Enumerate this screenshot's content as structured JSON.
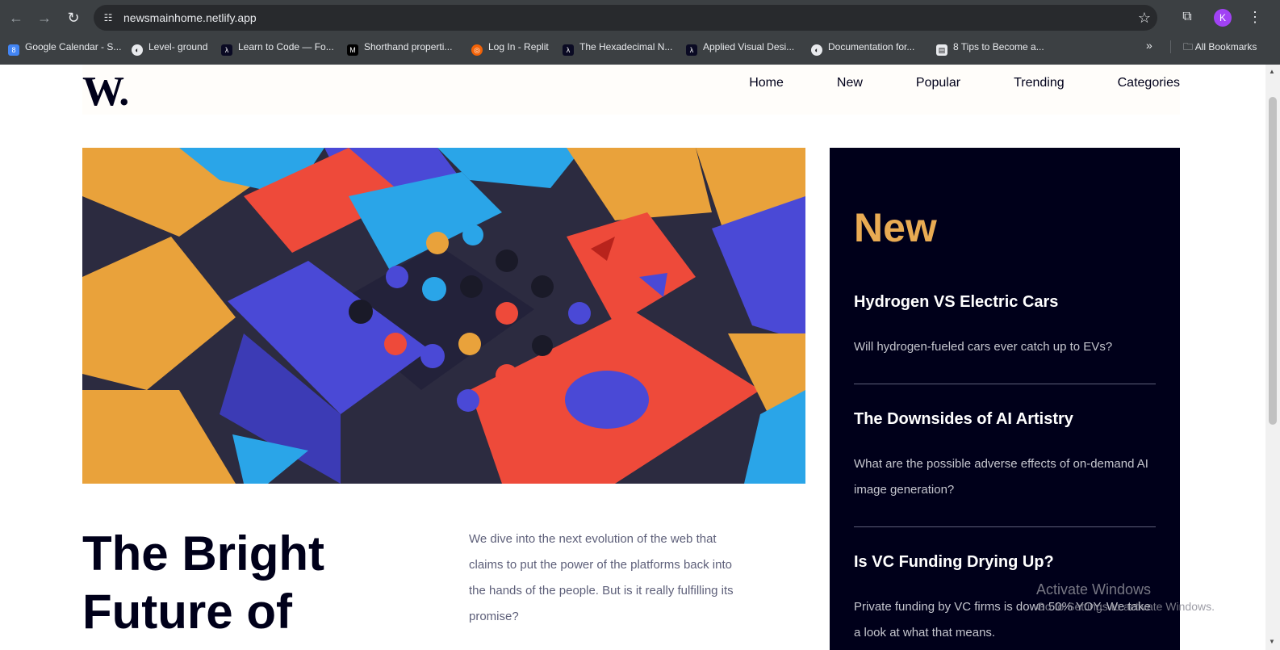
{
  "browser": {
    "url": "newsmainhome.netlify.app",
    "avatar_letter": "K",
    "bookmarks": [
      {
        "label": "Google Calendar - S...",
        "icon": "calendar-icon"
      },
      {
        "label": "Level- ground",
        "icon": "globe-icon"
      },
      {
        "label": "Learn to Code — Fo...",
        "icon": "freecodecamp-icon"
      },
      {
        "label": "Shorthand properti...",
        "icon": "mdn-icon"
      },
      {
        "label": "Log In - Replit",
        "icon": "replit-icon"
      },
      {
        "label": "The Hexadecimal N...",
        "icon": "freecodecamp-icon"
      },
      {
        "label": "Applied Visual Desi...",
        "icon": "freecodecamp-icon"
      },
      {
        "label": "Documentation for...",
        "icon": "globe-icon"
      },
      {
        "label": "8 Tips to Become a...",
        "icon": "article-icon"
      }
    ],
    "all_bookmarks": "All Bookmarks"
  },
  "site": {
    "logo": "W.",
    "nav": [
      "Home",
      "New",
      "Popular",
      "Trending",
      "Categories"
    ]
  },
  "main": {
    "headline": "The Bright Future of",
    "lede": "We dive into the next evolution of the web that claims to put the power of the platforms back into the hands of the people. But is it really fulfilling its promise?"
  },
  "aside": {
    "title": "New",
    "items": [
      {
        "title": "Hydrogen VS Electric Cars",
        "text": "Will hydrogen-fueled cars ever catch up to EVs?"
      },
      {
        "title": "The Downsides of AI Artistry",
        "text": "What are the possible adverse effects of on-demand AI image generation?"
      },
      {
        "title": "Is VC Funding Drying Up?",
        "text": "Private funding by VC firms is down 50% YOY. We take a look at what that means."
      }
    ]
  },
  "os": {
    "activate_title": "Activate Windows",
    "activate_sub": "Go to Settings to activate Windows."
  },
  "colors": {
    "accent": "#e9ab53",
    "dark": "#00001a",
    "muted": "#5d5f79"
  }
}
